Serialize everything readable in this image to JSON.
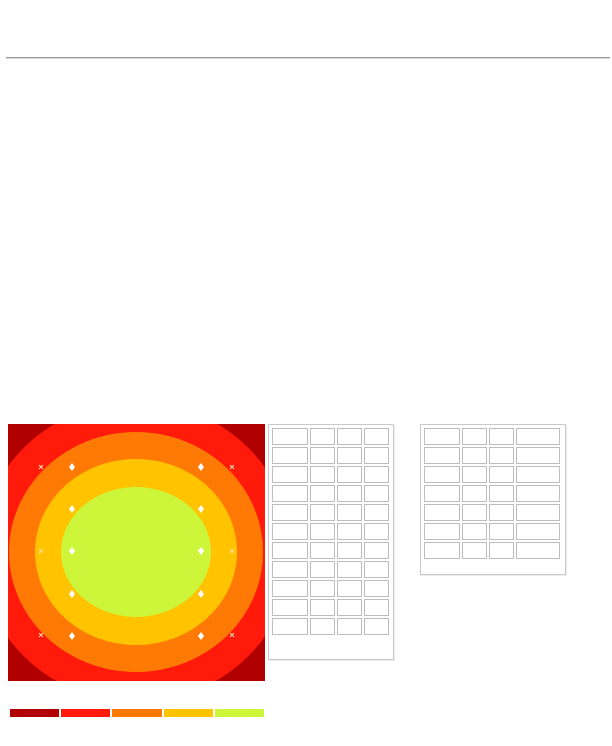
{
  "heatmap": {
    "colors": {
      "band_1": "#b00000",
      "band_2": "#ff1a0a",
      "band_3": "#ff7a05",
      "band_4": "#ffc300",
      "band_5": "#cdf53a"
    },
    "markers": {
      "diamond_color": "#ffffff",
      "cross_color": "#ffe0a0"
    }
  },
  "legend": {
    "swatches": [
      "#b00000",
      "#ff1a0a",
      "#ff7a05",
      "#ffc300",
      "#cdf53a"
    ]
  },
  "tables": {
    "left": {
      "rows": 11,
      "columns": 4,
      "cells": [
        [
          "",
          "",
          "",
          ""
        ],
        [
          "",
          "",
          "",
          ""
        ],
        [
          "",
          "",
          "",
          ""
        ],
        [
          "",
          "",
          "",
          ""
        ],
        [
          "",
          "",
          "",
          ""
        ],
        [
          "",
          "",
          "",
          ""
        ],
        [
          "",
          "",
          "",
          ""
        ],
        [
          "",
          "",
          "",
          ""
        ],
        [
          "",
          "",
          "",
          ""
        ],
        [
          "",
          "",
          "",
          ""
        ],
        [
          "",
          "",
          "",
          ""
        ]
      ]
    },
    "right": {
      "rows": 7,
      "columns": 4,
      "cells": [
        [
          "",
          "",
          "",
          ""
        ],
        [
          "",
          "",
          "",
          ""
        ],
        [
          "",
          "",
          "",
          ""
        ],
        [
          "",
          "",
          "",
          ""
        ],
        [
          "",
          "",
          "",
          ""
        ],
        [
          "",
          "",
          "",
          ""
        ],
        [
          "",
          "",
          "",
          ""
        ]
      ]
    }
  }
}
